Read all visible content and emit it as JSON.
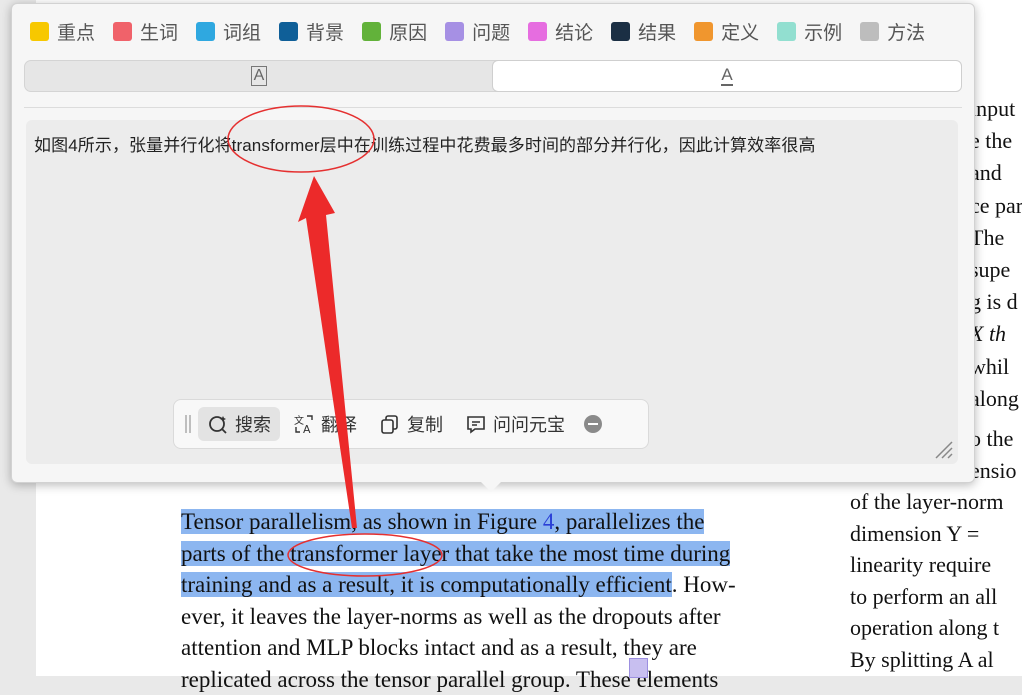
{
  "tags": [
    {
      "label": "重点",
      "color": "#f7c800"
    },
    {
      "label": "生词",
      "color": "#f0626a"
    },
    {
      "label": "词组",
      "color": "#2fa8e0"
    },
    {
      "label": "背景",
      "color": "#0f5f98"
    },
    {
      "label": "原因",
      "color": "#62b23a"
    },
    {
      "label": "问题",
      "color": "#a690e4"
    },
    {
      "label": "结论",
      "color": "#e66de0"
    },
    {
      "label": "结果",
      "color": "#1b2f44"
    },
    {
      "label": "定义",
      "color": "#f0962e"
    },
    {
      "label": "示例",
      "color": "#92dfd0"
    },
    {
      "label": "方法",
      "color": "#bdbdbd"
    }
  ],
  "segments": {
    "left_glyph": "A",
    "right_glyph": "A"
  },
  "translation_text": "如图4所示，张量并行化将transformer层中在训练过程中花费最多时间的部分并行化，因此计算效率很高",
  "toolbar": {
    "search": "搜索",
    "translate": "翻译",
    "copy": "复制",
    "ask": "问问元宝"
  },
  "doc_left": {
    "l1_a": "Tensor parallelism, as shown in Figure ",
    "l1_link": "4",
    "l1_b": ", parallelizes the",
    "l2": "parts of the transformer layer that take the most time during",
    "l3_hl": "training and as a result, it is computationally efficient",
    "l3_rest": ". How-",
    "l4": "ever, it leaves the layer-norms as well as the dropouts after",
    "l5": "attention and MLP blocks intact and as a result, they are",
    "l6": "replicated across the tensor parallel group. These elements"
  },
  "doc_right_top": [
    "input",
    "e the",
    "and",
    "ce par",
    "The",
    "supe",
    "g is d",
    "X th",
    "whil",
    "along"
  ],
  "doc_right_bottom": [
    "o the",
    "ensio",
    "of the layer-norm",
    "dimension Y =",
    "linearity require",
    "to perform an all",
    "operation along t",
    "By splitting A al"
  ]
}
